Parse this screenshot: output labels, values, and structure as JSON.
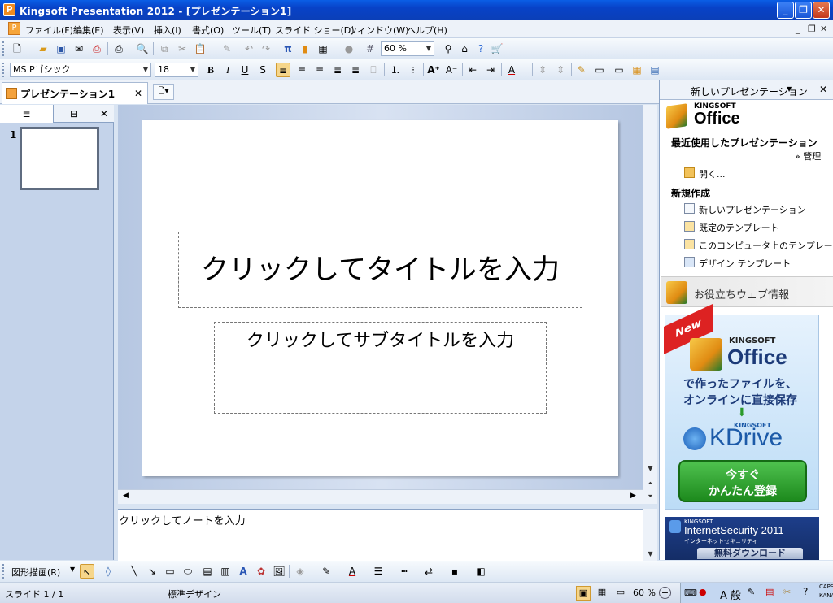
{
  "window": {
    "title": "Kingsoft Presentation 2012 - [プレゼンテーション1]",
    "app_icon": "P"
  },
  "menu": {
    "items": [
      "ファイル(F)",
      "編集(E)",
      "表示(V)",
      "挿入(I)",
      "書式(O)",
      "ツール(T)",
      "スライド ショー(D)",
      "ウィンドウ(W)",
      "ヘルプ(H)"
    ],
    "app_icon": "P"
  },
  "toolbar": {
    "zoom": "60 %"
  },
  "format_toolbar": {
    "font": "MS Pゴシック",
    "size": "18"
  },
  "tabs": {
    "document": "プレゼンテーション1"
  },
  "slides_pane": {
    "slide_number": "1"
  },
  "slide": {
    "title_placeholder": "クリックしてタイトルを入力",
    "subtitle_placeholder": "クリックしてサブタイトルを入力"
  },
  "notes": {
    "placeholder": "クリックしてノートを入力"
  },
  "task_pane": {
    "header": "新しいプレゼンテーション",
    "logo_small": "KINGSOFT",
    "logo_big": "Office",
    "recent_heading": "最近使用したプレゼンテーション",
    "manage": "» 管理",
    "open": "開く...",
    "new_heading": "新規作成",
    "new_links": [
      "新しいプレゼンテーション",
      "既定のテンプレート",
      "このコンピュータ上のテンプレート...",
      "デザイン テンプレート"
    ],
    "web_info": "お役立ちウェブ情報"
  },
  "ad_kdrive": {
    "badge": "New",
    "brand_small": "KINGSOFT",
    "brand": "Office",
    "line1": "で作ったファイルを、",
    "line2": "オンラインに直接保存",
    "kd_small": "KINGSOFT",
    "kd": "KDrive",
    "btn1": "今すぐ",
    "btn2": "かんたん登録"
  },
  "ad_security": {
    "brand_small": "KINGSOFT",
    "name": "InternetSecurity 2011",
    "sub": "インターネットセキュリティ",
    "btn": "無料ダウンロード"
  },
  "drawbar": {
    "label": "図形描画(R)"
  },
  "status": {
    "slide": "スライド 1 / 1",
    "design": "標準デザイン",
    "zoom": "60 %",
    "caps": "CAPS",
    "kana": "KANA",
    "ime": "A 般"
  },
  "colors": {
    "accent": "#0a5ee6",
    "menu_bg": "#edf2f9",
    "pane_bg": "#c4d3ea"
  }
}
